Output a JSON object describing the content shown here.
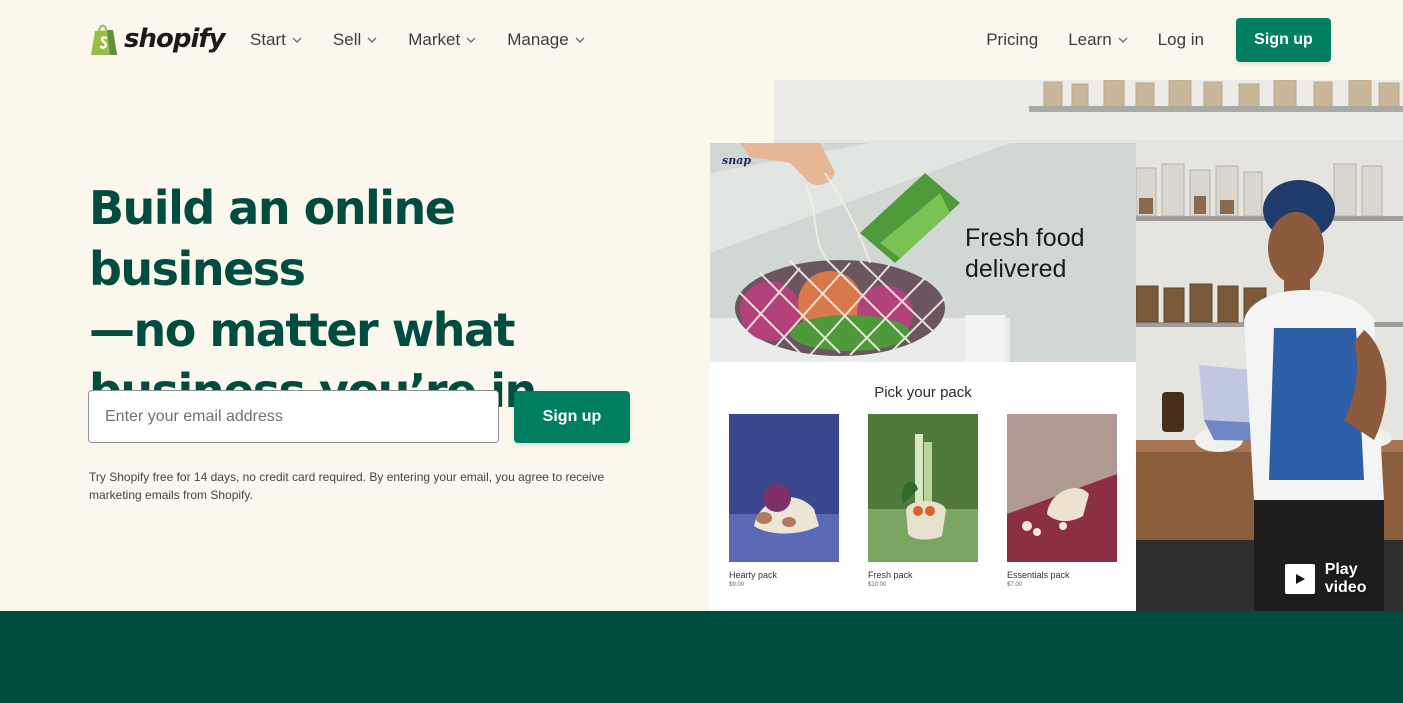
{
  "brand": {
    "name": "shopify",
    "accent": "#008060",
    "dark": "#004c3f",
    "background": "#fbf7ed"
  },
  "nav": {
    "left": [
      {
        "label": "Start",
        "icon": "chevron-down-icon"
      },
      {
        "label": "Sell",
        "icon": "chevron-down-icon"
      },
      {
        "label": "Market",
        "icon": "chevron-down-icon"
      },
      {
        "label": "Manage",
        "icon": "chevron-down-icon"
      }
    ],
    "pricing": "Pricing",
    "learn": "Learn",
    "login": "Log in",
    "signup": "Sign up"
  },
  "hero": {
    "line1": "Build an online business",
    "line2": "—no matter what",
    "line3": "business you’re in",
    "email_placeholder": "Enter your email address",
    "signup": "Sign up",
    "disclaimer": "Try Shopify free for 14 days, no credit card required. By entering your email, you agree to receive marketing emails from Shopify."
  },
  "mockup": {
    "logo": "snap",
    "tagline_1": "Fresh food",
    "tagline_2": "delivered",
    "section_title": "Pick your pack",
    "packs": [
      {
        "name": "Hearty pack",
        "price": "$9.00",
        "color": "#3d4a8c"
      },
      {
        "name": "Fresh pack",
        "price": "$10.00",
        "color": "#5e8a4a"
      },
      {
        "name": "Essentials pack",
        "price": "$7.00",
        "color": "#8c2f43"
      }
    ]
  },
  "video": {
    "label": "Play video",
    "icon": "play-icon"
  }
}
